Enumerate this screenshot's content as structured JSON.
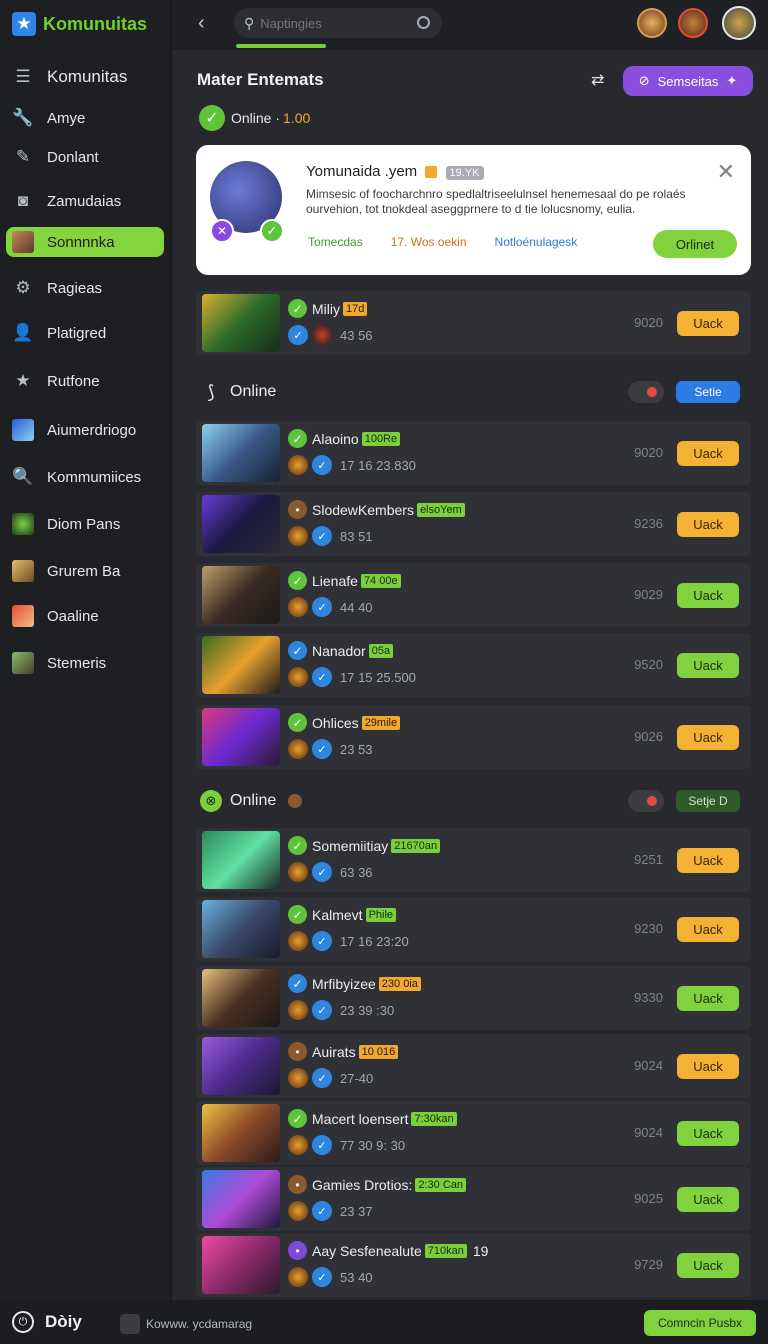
{
  "sidebar": {
    "brand": "Komunuitas",
    "items": [
      {
        "label": "Komunitas",
        "icon": "menu-icon"
      },
      {
        "label": "Amye",
        "icon": "wrench-icon"
      },
      {
        "label": "Donlant",
        "icon": "edit-icon"
      },
      {
        "label": "Zamudaias",
        "icon": "camera-icon"
      },
      {
        "label": "Sonnnnka",
        "icon": "avatar-thumb"
      },
      {
        "label": "Ragieas",
        "icon": "gear-icon"
      },
      {
        "label": "Platigred",
        "icon": "user-icon"
      },
      {
        "label": "Rutfone",
        "icon": "star-icon"
      },
      {
        "label": "Aiumerdriogo",
        "icon": "game-thumb"
      },
      {
        "label": "Kommumiices",
        "icon": "search-icon"
      },
      {
        "label": "Diom Pans",
        "icon": "game-thumb"
      },
      {
        "label": "Grurem Ba",
        "icon": "avatar-thumb"
      },
      {
        "label": "Oaaline",
        "icon": "avatar-thumb"
      },
      {
        "label": "Stemeris",
        "icon": "avatar-thumb"
      }
    ]
  },
  "topbar": {
    "search_placeholder": "Naptingies"
  },
  "main": {
    "title": "Mater Entemats",
    "action_button": "Semseitas",
    "online_label": "Online ·",
    "online_count": "1.00"
  },
  "card": {
    "title": "Yomunaida .yem",
    "tag": "19.YK",
    "description": "Mimsesic of foocharchnro spedlaltriseelulnsel henemesaal do pe rolaés ourvehion, tot tnokdeal aseggprnere to d tie lolucsnomy, eulia.",
    "stats": [
      "Tomecdas",
      "17. Wos oekin",
      "Notloénulagesk"
    ],
    "button": "Orlinet"
  },
  "top_row": {
    "name": "Miliy",
    "badge": "17d",
    "sub": "43 56",
    "num": "9020",
    "btn": "Uack"
  },
  "section1": {
    "label": "Online",
    "button": "Setie"
  },
  "section2": {
    "label": "Online",
    "button": "Setje D"
  },
  "rows1": [
    {
      "name": "Alaoino",
      "badge": "100Re",
      "sub": "17 16  23.830",
      "num": "9020",
      "btn": "Uack"
    },
    {
      "name": "SlodewKembers",
      "badge": "elsoYem",
      "sub": "83 51",
      "num": "9236",
      "btn": "Uack"
    },
    {
      "name": "Lienafe",
      "badge": "74 00e",
      "sub": "44 40",
      "num": "9029",
      "btn": "Uack"
    },
    {
      "name": "Nanador",
      "badge": "05a",
      "sub": "17 15  25.500",
      "num": "9520",
      "btn": "Uack"
    },
    {
      "name": "Ohlices",
      "badge": "29mile",
      "sub": "23 53",
      "num": "9026",
      "btn": "Uack"
    }
  ],
  "rows2": [
    {
      "name": "Somemiitiay",
      "badge": "21670an",
      "sub": "63 36",
      "num": "9251",
      "btn": "Uack"
    },
    {
      "name": "Kalmevt",
      "badge": "Phile",
      "sub": "17 16  23:20",
      "num": "9230",
      "btn": "Uack"
    },
    {
      "name": "Mrfibyizee",
      "badge": "230 0ia",
      "sub": "23 39  :30",
      "num": "9330",
      "btn": "Uack"
    },
    {
      "name": "Auirats",
      "badge": "10 016",
      "sub": "27-40",
      "num": "9024",
      "btn": "Uack"
    },
    {
      "name": "Macert loensert",
      "badge": "7:30kan",
      "sub": "77 30  9: 30",
      "num": "9024",
      "btn": "Uack"
    },
    {
      "name": "Gamies Drotios:",
      "badge": "2:30 Can",
      "sub": "23 37",
      "num": "9025",
      "btn": "Uack"
    },
    {
      "name": "Aay Sesfenealute",
      "badge": "710kan",
      "extra": "19",
      "sub": "53 40",
      "num": "9729",
      "btn": "Uack"
    }
  ],
  "footer": {
    "title": "Dòiy",
    "url": "Kowww. ycdamarag",
    "button": "Comncin Pusbx"
  },
  "colors": {
    "accent_green": "#80d23f",
    "accent_orange": "#f4b234",
    "accent_purple": "#8b4fdf",
    "accent_blue": "#2e7be8",
    "background": "#27292e",
    "sidebar": "#1d1f23"
  }
}
